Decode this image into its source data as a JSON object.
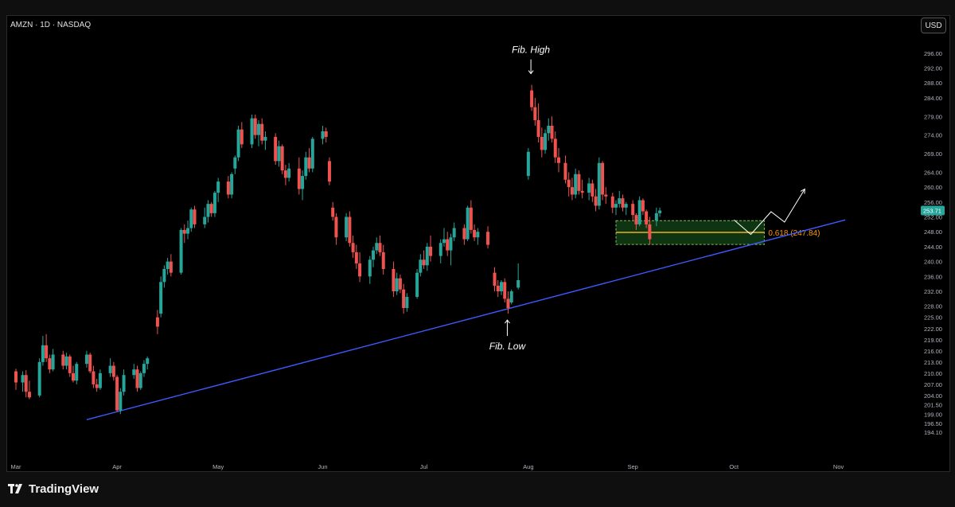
{
  "header": {
    "symbol": "AMZN · 1D · NASDAQ",
    "currency_button": "USD"
  },
  "branding": {
    "logo_text": "TradingView"
  },
  "colors": {
    "up": "#26a69a",
    "down": "#ef5350",
    "trendline": "#3d5afe",
    "fib_line": "#e6b422",
    "zone_fill": "#1b5e20",
    "zone_border": "#7fbf5f",
    "fib_label": "#ff9800",
    "annotation": "#ffffff"
  },
  "chart_data": {
    "type": "candlestick",
    "ylim": [
      192,
      298
    ],
    "y_ticks": [
      "296.00",
      "292.00",
      "288.00",
      "284.00",
      "279.00",
      "274.00",
      "269.00",
      "264.00",
      "260.00",
      "256.00",
      "252.00",
      "248.00",
      "244.00",
      "240.00",
      "236.00",
      "232.00",
      "228.00",
      "225.00",
      "222.00",
      "219.00",
      "216.00",
      "213.00",
      "210.00",
      "207.00",
      "204.00",
      "201.50",
      "199.00",
      "196.50",
      "194.10"
    ],
    "x_labels": [
      {
        "label": "Mar",
        "day": 0
      },
      {
        "label": "Apr",
        "day": 30
      },
      {
        "label": "May",
        "day": 60
      },
      {
        "label": "Jun",
        "day": 91
      },
      {
        "label": "Jul",
        "day": 121
      },
      {
        "label": "Aug",
        "day": 152
      },
      {
        "label": "Sep",
        "day": 183
      },
      {
        "label": "Oct",
        "day": 213
      },
      {
        "label": "Nov",
        "day": 244
      }
    ],
    "last_price": "253.71",
    "annotations": {
      "fib_high": "Fib. High",
      "fib_low": "Fib. Low",
      "fib_level_label": "0.618 (247.84)"
    },
    "fib_level": 247.84,
    "zone": {
      "from_day": 178,
      "to_day": 222,
      "low": 244.6,
      "high": 251.0
    },
    "trendline": {
      "start": {
        "day": 21,
        "price": 197.5
      },
      "end": {
        "day": 246,
        "price": 251.2
      }
    },
    "projection": [
      {
        "day": 213,
        "price": 251.2
      },
      {
        "day": 218,
        "price": 247.3
      },
      {
        "day": 224,
        "price": 253.4
      },
      {
        "day": 228,
        "price": 250.6
      },
      {
        "day": 234,
        "price": 259.5
      }
    ],
    "candles": [
      {
        "d": 0,
        "o": 210.5,
        "h": 211.2,
        "l": 205.5,
        "c": 207.5
      },
      {
        "d": 2,
        "o": 207.5,
        "h": 210.5,
        "l": 205.0,
        "c": 209.5
      },
      {
        "d": 3,
        "o": 209.5,
        "h": 210.8,
        "l": 203.5,
        "c": 205.0
      },
      {
        "d": 4,
        "o": 205.0,
        "h": 208.0,
        "l": 203.0,
        "c": 203.5
      },
      {
        "d": 7,
        "o": 204.0,
        "h": 214.0,
        "l": 203.5,
        "c": 213.0
      },
      {
        "d": 8,
        "o": 213.0,
        "h": 220.0,
        "l": 212.0,
        "c": 217.5
      },
      {
        "d": 9,
        "o": 217.5,
        "h": 220.5,
        "l": 213.0,
        "c": 214.0
      },
      {
        "d": 10,
        "o": 214.0,
        "h": 215.0,
        "l": 210.0,
        "c": 211.0
      },
      {
        "d": 11,
        "o": 211.0,
        "h": 216.5,
        "l": 210.5,
        "c": 215.0
      },
      {
        "d": 14,
        "o": 215.0,
        "h": 216.0,
        "l": 211.0,
        "c": 212.0
      },
      {
        "d": 15,
        "o": 212.0,
        "h": 215.5,
        "l": 211.0,
        "c": 214.5
      },
      {
        "d": 16,
        "o": 214.5,
        "h": 215.0,
        "l": 209.0,
        "c": 210.0
      },
      {
        "d": 17,
        "o": 210.0,
        "h": 212.0,
        "l": 207.5,
        "c": 208.0
      },
      {
        "d": 18,
        "o": 208.0,
        "h": 213.0,
        "l": 207.0,
        "c": 212.5
      },
      {
        "d": 21,
        "o": 212.5,
        "h": 216.0,
        "l": 211.5,
        "c": 215.0
      },
      {
        "d": 22,
        "o": 215.0,
        "h": 215.5,
        "l": 210.0,
        "c": 210.5
      },
      {
        "d": 23,
        "o": 210.5,
        "h": 212.0,
        "l": 206.0,
        "c": 207.0
      },
      {
        "d": 24,
        "o": 207.0,
        "h": 208.5,
        "l": 205.0,
        "c": 206.0
      },
      {
        "d": 25,
        "o": 206.0,
        "h": 211.0,
        "l": 205.5,
        "c": 210.0
      },
      {
        "d": 28,
        "o": 210.0,
        "h": 214.0,
        "l": 209.0,
        "c": 212.0
      },
      {
        "d": 29,
        "o": 212.0,
        "h": 213.0,
        "l": 208.0,
        "c": 209.0
      },
      {
        "d": 30,
        "o": 209.0,
        "h": 209.5,
        "l": 199.5,
        "c": 200.0
      },
      {
        "d": 31,
        "o": 200.0,
        "h": 206.0,
        "l": 199.0,
        "c": 205.0
      },
      {
        "d": 32,
        "o": 205.0,
        "h": 211.0,
        "l": 204.0,
        "c": 209.5
      },
      {
        "d": 35,
        "o": 209.5,
        "h": 212.5,
        "l": 208.5,
        "c": 211.0
      },
      {
        "d": 36,
        "o": 211.0,
        "h": 212.0,
        "l": 205.0,
        "c": 206.0
      },
      {
        "d": 37,
        "o": 206.0,
        "h": 210.5,
        "l": 205.5,
        "c": 210.0
      },
      {
        "d": 38,
        "o": 210.0,
        "h": 213.5,
        "l": 209.0,
        "c": 212.5
      },
      {
        "d": 39,
        "o": 212.5,
        "h": 214.5,
        "l": 211.0,
        "c": 214.0
      },
      {
        "d": 42,
        "o": 225.0,
        "h": 227.0,
        "l": 220.5,
        "c": 222.5
      },
      {
        "d": 43,
        "o": 226.0,
        "h": 236.0,
        "l": 225.0,
        "c": 234.5
      },
      {
        "d": 44,
        "o": 234.5,
        "h": 239.0,
        "l": 233.0,
        "c": 238.0
      },
      {
        "d": 45,
        "o": 238.0,
        "h": 241.0,
        "l": 236.5,
        "c": 240.0
      },
      {
        "d": 46,
        "o": 240.0,
        "h": 242.0,
        "l": 236.0,
        "c": 237.0
      },
      {
        "d": 49,
        "o": 237.0,
        "h": 249.0,
        "l": 236.5,
        "c": 248.5
      },
      {
        "d": 50,
        "o": 248.5,
        "h": 250.0,
        "l": 245.0,
        "c": 247.5
      },
      {
        "d": 51,
        "o": 247.5,
        "h": 251.0,
        "l": 246.0,
        "c": 249.0
      },
      {
        "d": 52,
        "o": 249.0,
        "h": 254.5,
        "l": 248.0,
        "c": 254.0
      },
      {
        "d": 53,
        "o": 254.0,
        "h": 255.0,
        "l": 249.0,
        "c": 250.0
      },
      {
        "d": 56,
        "o": 250.0,
        "h": 254.5,
        "l": 249.0,
        "c": 252.0
      },
      {
        "d": 57,
        "o": 252.0,
        "h": 256.5,
        "l": 250.5,
        "c": 255.5
      },
      {
        "d": 58,
        "o": 255.5,
        "h": 256.0,
        "l": 252.0,
        "c": 253.0
      },
      {
        "d": 59,
        "o": 253.0,
        "h": 259.0,
        "l": 252.0,
        "c": 258.5
      },
      {
        "d": 60,
        "o": 258.5,
        "h": 262.5,
        "l": 256.0,
        "c": 261.5
      },
      {
        "d": 63,
        "o": 261.5,
        "h": 263.0,
        "l": 257.0,
        "c": 258.0
      },
      {
        "d": 64,
        "o": 258.0,
        "h": 264.0,
        "l": 257.0,
        "c": 263.5
      },
      {
        "d": 65,
        "o": 265.0,
        "h": 268.5,
        "l": 263.5,
        "c": 268.0
      },
      {
        "d": 66,
        "o": 268.0,
        "h": 276.5,
        "l": 267.0,
        "c": 275.5
      },
      {
        "d": 67,
        "o": 275.5,
        "h": 277.5,
        "l": 270.5,
        "c": 271.5
      },
      {
        "d": 70,
        "o": 271.5,
        "h": 279.5,
        "l": 270.5,
        "c": 278.5
      },
      {
        "d": 71,
        "o": 278.5,
        "h": 279.5,
        "l": 273.0,
        "c": 274.0
      },
      {
        "d": 72,
        "o": 274.0,
        "h": 278.0,
        "l": 271.0,
        "c": 277.0
      },
      {
        "d": 73,
        "o": 277.0,
        "h": 278.5,
        "l": 271.5,
        "c": 272.5
      },
      {
        "d": 74,
        "o": 272.5,
        "h": 275.0,
        "l": 270.0,
        "c": 273.5
      },
      {
        "d": 77,
        "o": 273.5,
        "h": 274.5,
        "l": 266.0,
        "c": 267.0
      },
      {
        "d": 78,
        "o": 267.0,
        "h": 272.5,
        "l": 265.5,
        "c": 271.0
      },
      {
        "d": 79,
        "o": 271.0,
        "h": 271.5,
        "l": 263.5,
        "c": 264.5
      },
      {
        "d": 80,
        "o": 264.5,
        "h": 266.0,
        "l": 260.5,
        "c": 262.5
      },
      {
        "d": 81,
        "o": 262.5,
        "h": 266.5,
        "l": 261.5,
        "c": 265.0
      },
      {
        "d": 84,
        "o": 265.0,
        "h": 268.0,
        "l": 258.0,
        "c": 259.5
      },
      {
        "d": 85,
        "o": 259.5,
        "h": 264.5,
        "l": 256.5,
        "c": 263.0
      },
      {
        "d": 86,
        "o": 263.0,
        "h": 269.5,
        "l": 262.0,
        "c": 268.0
      },
      {
        "d": 87,
        "o": 268.0,
        "h": 270.5,
        "l": 264.0,
        "c": 265.0
      },
      {
        "d": 88,
        "o": 265.0,
        "h": 273.5,
        "l": 264.0,
        "c": 273.0
      },
      {
        "d": 91,
        "o": 273.0,
        "h": 276.5,
        "l": 271.5,
        "c": 275.0
      },
      {
        "d": 92,
        "o": 275.0,
        "h": 276.0,
        "l": 272.0,
        "c": 273.5
      },
      {
        "d": 93,
        "o": 267.0,
        "h": 268.0,
        "l": 260.5,
        "c": 261.5
      },
      {
        "d": 94,
        "o": 254.5,
        "h": 256.0,
        "l": 251.0,
        "c": 252.0
      },
      {
        "d": 95,
        "o": 252.0,
        "h": 253.0,
        "l": 244.5,
        "c": 246.5
      },
      {
        "d": 98,
        "o": 246.5,
        "h": 253.0,
        "l": 245.5,
        "c": 252.0
      },
      {
        "d": 99,
        "o": 252.0,
        "h": 253.5,
        "l": 244.0,
        "c": 245.0
      },
      {
        "d": 100,
        "o": 245.0,
        "h": 247.0,
        "l": 241.0,
        "c": 242.5
      },
      {
        "d": 101,
        "o": 242.5,
        "h": 244.5,
        "l": 238.0,
        "c": 239.5
      },
      {
        "d": 102,
        "o": 239.5,
        "h": 242.5,
        "l": 234.5,
        "c": 236.0
      },
      {
        "d": 105,
        "o": 236.0,
        "h": 241.5,
        "l": 234.0,
        "c": 240.5
      },
      {
        "d": 106,
        "o": 240.5,
        "h": 244.0,
        "l": 238.5,
        "c": 243.0
      },
      {
        "d": 107,
        "o": 243.0,
        "h": 246.5,
        "l": 242.0,
        "c": 245.0
      },
      {
        "d": 108,
        "o": 245.0,
        "h": 247.0,
        "l": 241.5,
        "c": 242.5
      },
      {
        "d": 109,
        "o": 242.5,
        "h": 244.5,
        "l": 236.5,
        "c": 238.0
      },
      {
        "d": 112,
        "o": 238.0,
        "h": 240.0,
        "l": 230.5,
        "c": 232.0
      },
      {
        "d": 113,
        "o": 232.0,
        "h": 237.0,
        "l": 231.0,
        "c": 235.5
      },
      {
        "d": 114,
        "o": 235.5,
        "h": 236.5,
        "l": 231.5,
        "c": 232.5
      },
      {
        "d": 115,
        "o": 232.5,
        "h": 234.0,
        "l": 226.0,
        "c": 227.5
      },
      {
        "d": 116,
        "o": 227.5,
        "h": 231.5,
        "l": 226.5,
        "c": 230.5
      },
      {
        "d": 119,
        "o": 230.5,
        "h": 238.0,
        "l": 230.0,
        "c": 237.0
      },
      {
        "d": 120,
        "o": 237.0,
        "h": 242.0,
        "l": 236.0,
        "c": 240.5
      },
      {
        "d": 121,
        "o": 240.5,
        "h": 243.0,
        "l": 238.0,
        "c": 239.0
      },
      {
        "d": 122,
        "o": 239.0,
        "h": 245.0,
        "l": 237.5,
        "c": 244.0
      },
      {
        "d": 123,
        "o": 244.0,
        "h": 247.0,
        "l": 240.0,
        "c": 241.5
      },
      {
        "d": 126,
        "o": 241.5,
        "h": 246.0,
        "l": 239.5,
        "c": 245.0
      },
      {
        "d": 127,
        "o": 245.0,
        "h": 249.0,
        "l": 244.0,
        "c": 246.0
      },
      {
        "d": 128,
        "o": 246.0,
        "h": 248.0,
        "l": 241.5,
        "c": 243.0
      },
      {
        "d": 129,
        "o": 243.0,
        "h": 247.5,
        "l": 239.0,
        "c": 246.5
      },
      {
        "d": 130,
        "o": 246.5,
        "h": 250.5,
        "l": 245.5,
        "c": 249.0
      },
      {
        "d": 133,
        "o": 249.0,
        "h": 250.0,
        "l": 244.5,
        "c": 246.0
      },
      {
        "d": 134,
        "o": 246.0,
        "h": 255.0,
        "l": 245.5,
        "c": 254.5
      },
      {
        "d": 135,
        "o": 254.5,
        "h": 256.5,
        "l": 247.5,
        "c": 248.5
      },
      {
        "d": 136,
        "o": 248.5,
        "h": 250.0,
        "l": 245.5,
        "c": 246.5
      },
      {
        "d": 137,
        "o": 246.5,
        "h": 249.0,
        "l": 244.5,
        "c": 248.0
      },
      {
        "d": 140,
        "o": 248.0,
        "h": 249.5,
        "l": 243.5,
        "c": 244.5
      },
      {
        "d": 142,
        "o": 237.0,
        "h": 238.5,
        "l": 232.0,
        "c": 233.5
      },
      {
        "d": 143,
        "o": 233.5,
        "h": 235.0,
        "l": 230.5,
        "c": 232.0
      },
      {
        "d": 144,
        "o": 232.0,
        "h": 235.0,
        "l": 231.0,
        "c": 234.5
      },
      {
        "d": 145,
        "o": 234.5,
        "h": 235.5,
        "l": 229.0,
        "c": 230.0
      },
      {
        "d": 146,
        "o": 230.0,
        "h": 232.0,
        "l": 226.0,
        "c": 227.5
      },
      {
        "d": 147,
        "o": 229.0,
        "h": 232.5,
        "l": 228.5,
        "c": 232.0
      },
      {
        "d": 149,
        "o": 233.0,
        "h": 239.5,
        "l": 232.5,
        "c": 235.0
      },
      {
        "d": 152,
        "o": 263.0,
        "h": 270.5,
        "l": 262.0,
        "c": 269.5
      },
      {
        "d": 153,
        "o": 286.0,
        "h": 287.5,
        "l": 280.5,
        "c": 281.5
      },
      {
        "d": 154,
        "o": 281.5,
        "h": 284.0,
        "l": 276.5,
        "c": 278.0
      },
      {
        "d": 155,
        "o": 278.0,
        "h": 282.5,
        "l": 272.0,
        "c": 273.5
      },
      {
        "d": 156,
        "o": 273.5,
        "h": 276.0,
        "l": 268.0,
        "c": 270.0
      },
      {
        "d": 157,
        "o": 270.0,
        "h": 275.5,
        "l": 269.0,
        "c": 274.5
      },
      {
        "d": 158,
        "o": 274.5,
        "h": 278.5,
        "l": 272.5,
        "c": 276.5
      },
      {
        "d": 159,
        "o": 276.5,
        "h": 279.0,
        "l": 272.0,
        "c": 273.0
      },
      {
        "d": 160,
        "o": 273.0,
        "h": 275.0,
        "l": 266.5,
        "c": 268.0
      },
      {
        "d": 161,
        "o": 268.0,
        "h": 270.5,
        "l": 264.0,
        "c": 266.5
      },
      {
        "d": 163,
        "o": 266.5,
        "h": 268.5,
        "l": 261.0,
        "c": 262.0
      },
      {
        "d": 164,
        "o": 262.0,
        "h": 264.0,
        "l": 257.5,
        "c": 260.0
      },
      {
        "d": 165,
        "o": 260.0,
        "h": 262.5,
        "l": 256.5,
        "c": 258.0
      },
      {
        "d": 166,
        "o": 258.0,
        "h": 265.0,
        "l": 257.0,
        "c": 263.5
      },
      {
        "d": 167,
        "o": 263.5,
        "h": 264.5,
        "l": 258.0,
        "c": 259.0
      },
      {
        "d": 168,
        "o": 259.0,
        "h": 262.0,
        "l": 257.0,
        "c": 258.5
      },
      {
        "d": 170,
        "o": 258.5,
        "h": 262.5,
        "l": 256.5,
        "c": 261.0
      },
      {
        "d": 171,
        "o": 261.0,
        "h": 262.0,
        "l": 256.0,
        "c": 257.5
      },
      {
        "d": 172,
        "o": 257.5,
        "h": 259.5,
        "l": 253.5,
        "c": 255.0
      },
      {
        "d": 173,
        "o": 255.0,
        "h": 268.0,
        "l": 254.0,
        "c": 266.5
      },
      {
        "d": 174,
        "o": 266.5,
        "h": 267.0,
        "l": 256.5,
        "c": 258.0
      },
      {
        "d": 175,
        "o": 258.0,
        "h": 260.0,
        "l": 255.5,
        "c": 257.5
      },
      {
        "d": 177,
        "o": 257.5,
        "h": 258.5,
        "l": 253.0,
        "c": 254.5
      },
      {
        "d": 178,
        "o": 254.5,
        "h": 256.5,
        "l": 252.5,
        "c": 255.5
      },
      {
        "d": 179,
        "o": 255.5,
        "h": 259.0,
        "l": 254.5,
        "c": 257.0
      },
      {
        "d": 180,
        "o": 257.0,
        "h": 258.0,
        "l": 253.5,
        "c": 254.5
      },
      {
        "d": 181,
        "o": 254.5,
        "h": 256.0,
        "l": 252.5,
        "c": 255.5
      },
      {
        "d": 183,
        "o": 255.5,
        "h": 256.5,
        "l": 251.0,
        "c": 252.5
      },
      {
        "d": 184,
        "o": 252.5,
        "h": 253.0,
        "l": 248.5,
        "c": 250.0
      },
      {
        "d": 185,
        "o": 250.0,
        "h": 257.5,
        "l": 249.5,
        "c": 256.5
      },
      {
        "d": 186,
        "o": 256.5,
        "h": 257.0,
        "l": 252.5,
        "c": 253.5
      },
      {
        "d": 187,
        "o": 253.5,
        "h": 254.0,
        "l": 249.0,
        "c": 250.0
      },
      {
        "d": 188,
        "o": 250.0,
        "h": 252.0,
        "l": 244.5,
        "c": 246.0
      },
      {
        "d": 190,
        "o": 251.0,
        "h": 254.5,
        "l": 249.5,
        "c": 253.0
      },
      {
        "d": 191,
        "o": 253.0,
        "h": 254.5,
        "l": 252.0,
        "c": 253.71
      }
    ]
  }
}
